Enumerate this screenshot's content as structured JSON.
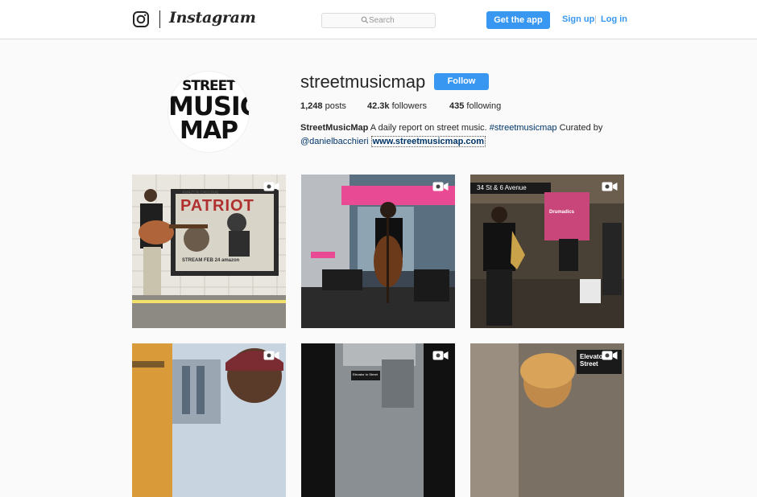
{
  "header": {
    "logo_text": "Instagram",
    "search_placeholder": "Search",
    "get_app_label": "Get the app",
    "signup_label": "Sign up",
    "separator": "|",
    "login_label": "Log in"
  },
  "profile": {
    "avatar_lines": [
      "STREET",
      "MUSIC",
      "MAP"
    ],
    "username": "streetmusicmap",
    "follow_label": "Follow",
    "posts_count": "1,248",
    "posts_label": "posts",
    "followers_count": "42.3k",
    "followers_label": "followers",
    "following_count": "435",
    "following_label": "following",
    "bio_name": "StreetMusicMap",
    "bio_text": " A daily report on street music. ",
    "bio_hashtag": "#streetmusicmap",
    "bio_text_after": " Curated by",
    "bio_mention": "@danielbacchieri",
    "bio_link": "www.streetmusicmap.com"
  },
  "grid": {
    "posts": [
      {
        "icon": "video-camera-icon",
        "poster_title": "PATRIOT",
        "poster_top": "AMAZON ORIGINAL",
        "poster_bottom": "STREAM FEB 24 amazon"
      },
      {
        "icon": "video-camera-icon"
      },
      {
        "icon": "video-camera-icon",
        "sign_text": "34 St & 6 Avenue",
        "banner_text": "Drumadics"
      },
      {
        "icon": "video-camera-icon"
      },
      {
        "icon": "video-camera-icon",
        "sign_text": "Elevator to Street"
      },
      {
        "icon": "video-camera-icon",
        "sign_text": "Elevator Street"
      }
    ]
  },
  "colors": {
    "brand_blue": "#3897f0",
    "link_navy": "#003569",
    "border": "#dbdbdb",
    "background": "#fafafa"
  }
}
